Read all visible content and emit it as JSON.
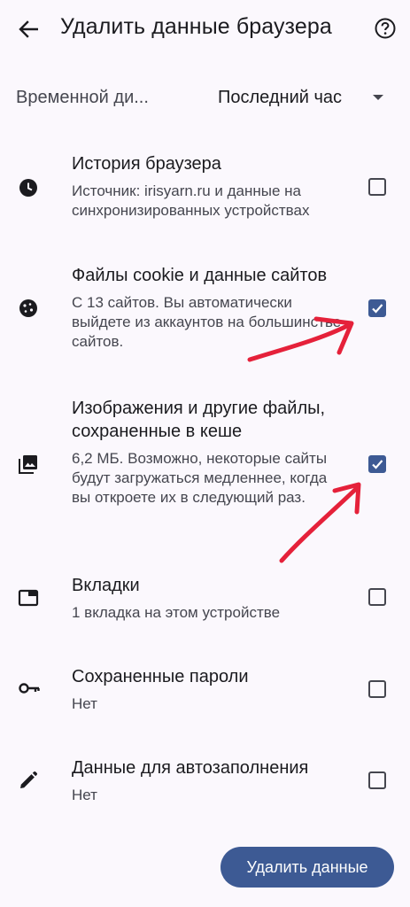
{
  "header": {
    "title": "Удалить данные браузера",
    "back_icon": "arrow-back-icon",
    "help_icon": "help-circle-icon"
  },
  "time_range": {
    "label": "Временной ди...",
    "value": "Последний час",
    "dropdown_icon": "caret-down-icon"
  },
  "items": [
    {
      "icon": "clock-icon",
      "title": "История браузера",
      "subtitle": "Источник: irisyarn.ru и данные на синхронизированных устройствах",
      "checked": false
    },
    {
      "icon": "cookie-icon",
      "title": "Файлы cookie и данные сайтов",
      "subtitle": "С 13 сайтов. Вы автоматически выйдете из аккаунтов на большинстве сайтов.",
      "checked": true
    },
    {
      "icon": "image-stack-icon",
      "title": "Изображения и другие файлы, сохраненные в кеше",
      "subtitle": "6,2 МБ. Возможно, некоторые сайты будут загружаться медленнее, когда вы откроете их в следующий раз.",
      "checked": true
    },
    {
      "icon": "tab-icon",
      "title": "Вкладки",
      "subtitle": "1 вкладка на этом устройстве",
      "checked": false
    },
    {
      "icon": "key-icon",
      "title": "Сохраненные пароли",
      "subtitle": "Нет",
      "checked": false
    },
    {
      "icon": "pencil-icon",
      "title": "Данные для автозаполнения",
      "subtitle": "Нет",
      "checked": false
    }
  ],
  "actions": {
    "delete_label": "Удалить данные"
  },
  "colors": {
    "accent": "#3d5a94",
    "background": "#fbf8fd",
    "annotation": "#e5213a"
  }
}
